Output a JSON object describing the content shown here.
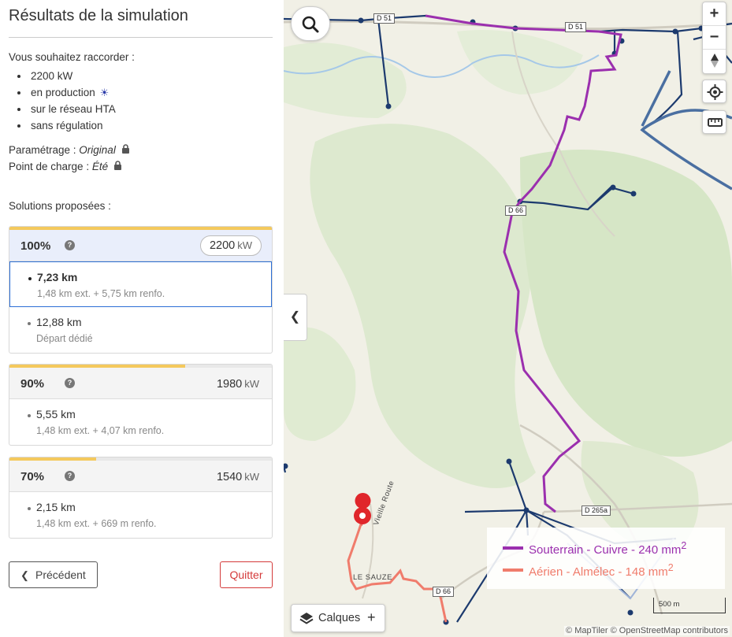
{
  "panel": {
    "title": "Résultats de la simulation",
    "intro": "Vous souhaitez raccorder :",
    "bullets": [
      "2200 kW",
      "en production",
      "sur le réseau HTA",
      "sans régulation"
    ],
    "param_label": "Paramétrage : ",
    "param_value": "Original",
    "charge_label": "Point de charge : ",
    "charge_value": "Été",
    "solutions_title": "Solutions proposées :",
    "cards": [
      {
        "percent": "100%",
        "power": "2200",
        "unit": "kW",
        "fill": 1.0,
        "active": true,
        "options": [
          {
            "distance": "7,23 km",
            "detail": "1,48 km ext. + 5,75 km renfo.",
            "selected": true
          },
          {
            "distance": "12,88 km",
            "detail": "Départ dédié",
            "selected": false
          }
        ]
      },
      {
        "percent": "90%",
        "power": "1980",
        "unit": "kW",
        "fill": 0.67,
        "active": false,
        "options": [
          {
            "distance": "5,55 km",
            "detail": "1,48 km ext. + 4,07 km renfo.",
            "selected": false
          }
        ]
      },
      {
        "percent": "70%",
        "power": "1540",
        "unit": "kW",
        "fill": 0.33,
        "active": false,
        "options": [
          {
            "distance": "2,15 km",
            "detail": "1,48 km ext. + 669 m renfo.",
            "selected": false
          }
        ]
      }
    ],
    "prev_label": "Précédent",
    "quit_label": "Quitter"
  },
  "map": {
    "legend": [
      {
        "label": "Souterrain - Cuivre - 240 mm",
        "sup": "2",
        "color": "#9b2fae"
      },
      {
        "label": "Aérien - Almélec - 148 mm",
        "sup": "2",
        "color": "#f07c6c"
      }
    ],
    "layers_label": "Calques",
    "scale_label": "500 m",
    "attribution": "© MapTiler © OpenStreetMap contributors",
    "roads": [
      "D 51",
      "D 51",
      "D 66",
      "D 265a",
      "D 66"
    ],
    "places": [
      "LE SAUZE",
      "Vieille Route"
    ],
    "icons": [
      "search-icon",
      "zoom-in-icon",
      "zoom-out-icon",
      "compass-icon",
      "locate-icon",
      "ruler-icon",
      "layers-icon",
      "chevron-left-icon",
      "map-pin-icon",
      "lock-icon",
      "sun-icon",
      "help-icon"
    ]
  }
}
